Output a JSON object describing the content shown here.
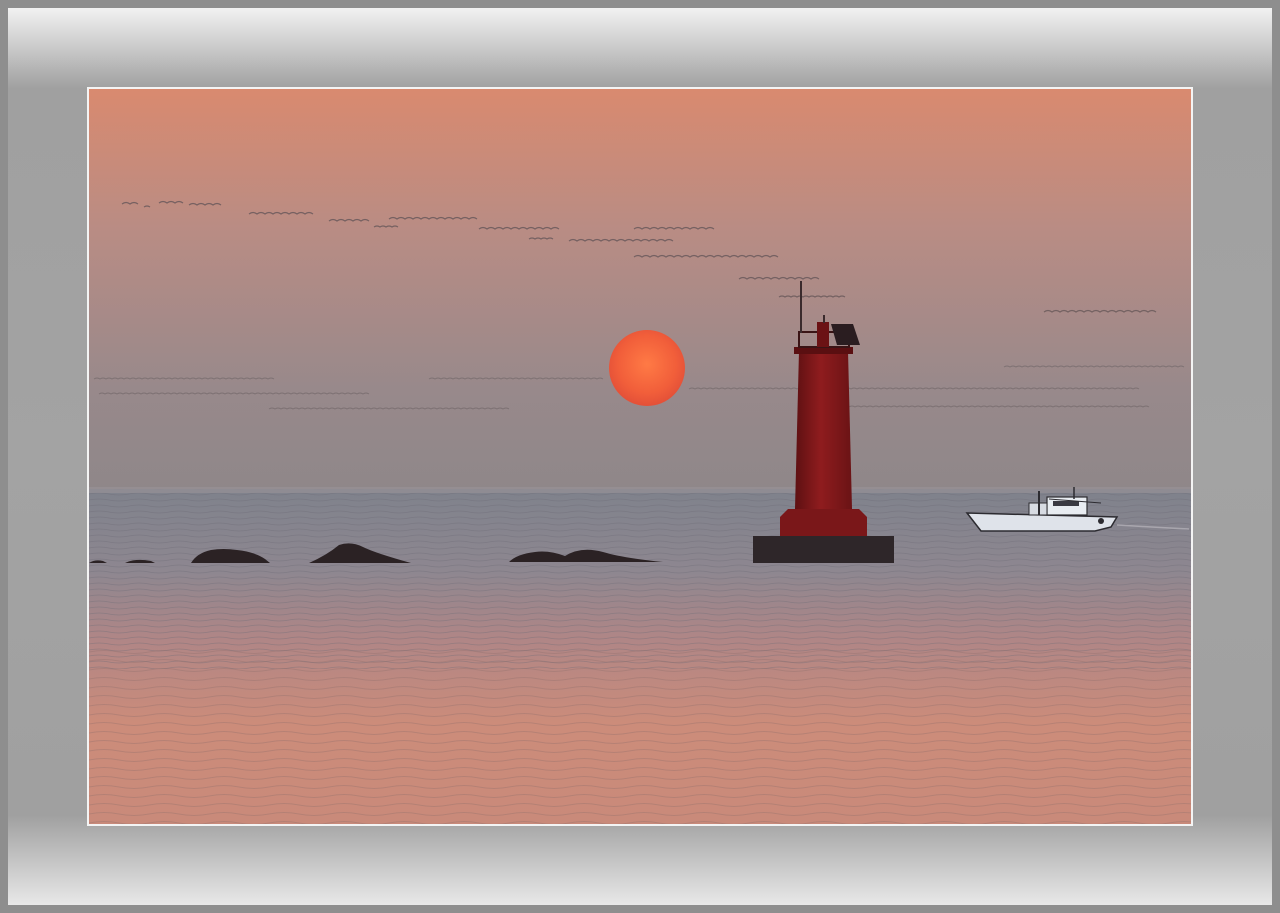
{
  "scene": {
    "subject": "sunset-seascape",
    "colors": {
      "sky_top": "#d98a6f",
      "sky_mid": "#b38b86",
      "sky_horizon": "#8f8789",
      "sun_core": "#f56a3d",
      "sun_edge": "#e8553a",
      "lighthouse": "#8a1a1c",
      "sea_near": "#cf8d78",
      "sea_far": "#7c7e88",
      "frame": "#a3a3a3"
    }
  }
}
